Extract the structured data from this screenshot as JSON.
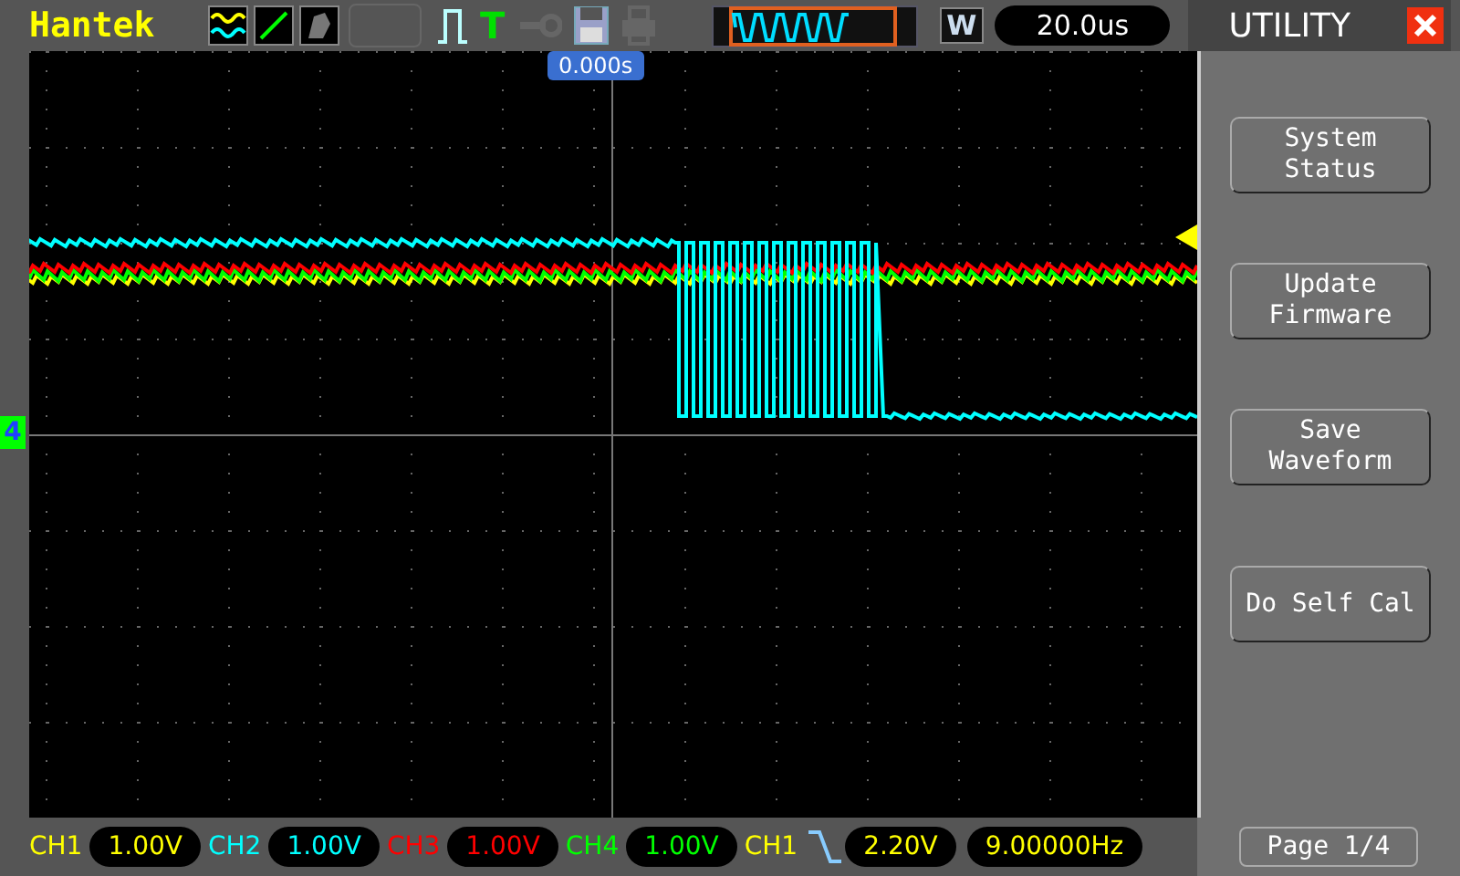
{
  "header": {
    "brand": "Hantek",
    "trigger_mode_label": "T",
    "zoom_label": "W",
    "timebase": "20.0us"
  },
  "screen": {
    "trigger_position": "0.000s",
    "ground_marker": "4"
  },
  "menu": {
    "title": "UTILITY",
    "buttons": [
      {
        "lines": [
          "System",
          "Status"
        ]
      },
      {
        "lines": [
          "Update",
          "Firmware"
        ]
      },
      {
        "lines": [
          "Save",
          "Waveform"
        ]
      },
      {
        "lines": [
          "Do Self Cal"
        ]
      }
    ],
    "page": "Page 1/4"
  },
  "channels": [
    {
      "label": "CH1",
      "scale": "1.00V",
      "color": "#ffff00"
    },
    {
      "label": "CH2",
      "scale": "1.00V",
      "color": "#00ffff"
    },
    {
      "label": "CH3",
      "scale": "1.00V",
      "color": "#ff0000"
    },
    {
      "label": "CH4",
      "scale": "1.00V",
      "color": "#00ff00"
    }
  ],
  "trigger": {
    "source": "CH1",
    "level": "2.20V",
    "frequency": "9.00000Hz"
  }
}
